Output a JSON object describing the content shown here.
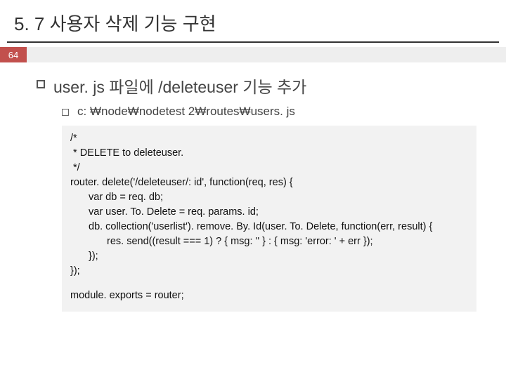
{
  "title": "5. 7 사용자 삭제 기능 구현",
  "pageNumber": "64",
  "bullet": "user. js 파일에 /deleteuser 기능 추가",
  "subBullet": "c: ₩node₩nodetest 2₩routes₩users. js",
  "code": {
    "l1": "/*",
    "l2": " * DELETE to deleteuser.",
    "l3": " */",
    "l4": "router. delete('/deleteuser/: id', function(req, res) {",
    "l5": "var db = req. db;",
    "l6": "var user. To. Delete = req. params. id;",
    "l7": "db. collection('userlist'). remove. By. Id(user. To. Delete, function(err, result) {",
    "l8": "res. send((result === 1) ? { msg: '' } : { msg: 'error: ' + err });",
    "l9": "});",
    "l10": "});",
    "l11": "module. exports = router;"
  }
}
